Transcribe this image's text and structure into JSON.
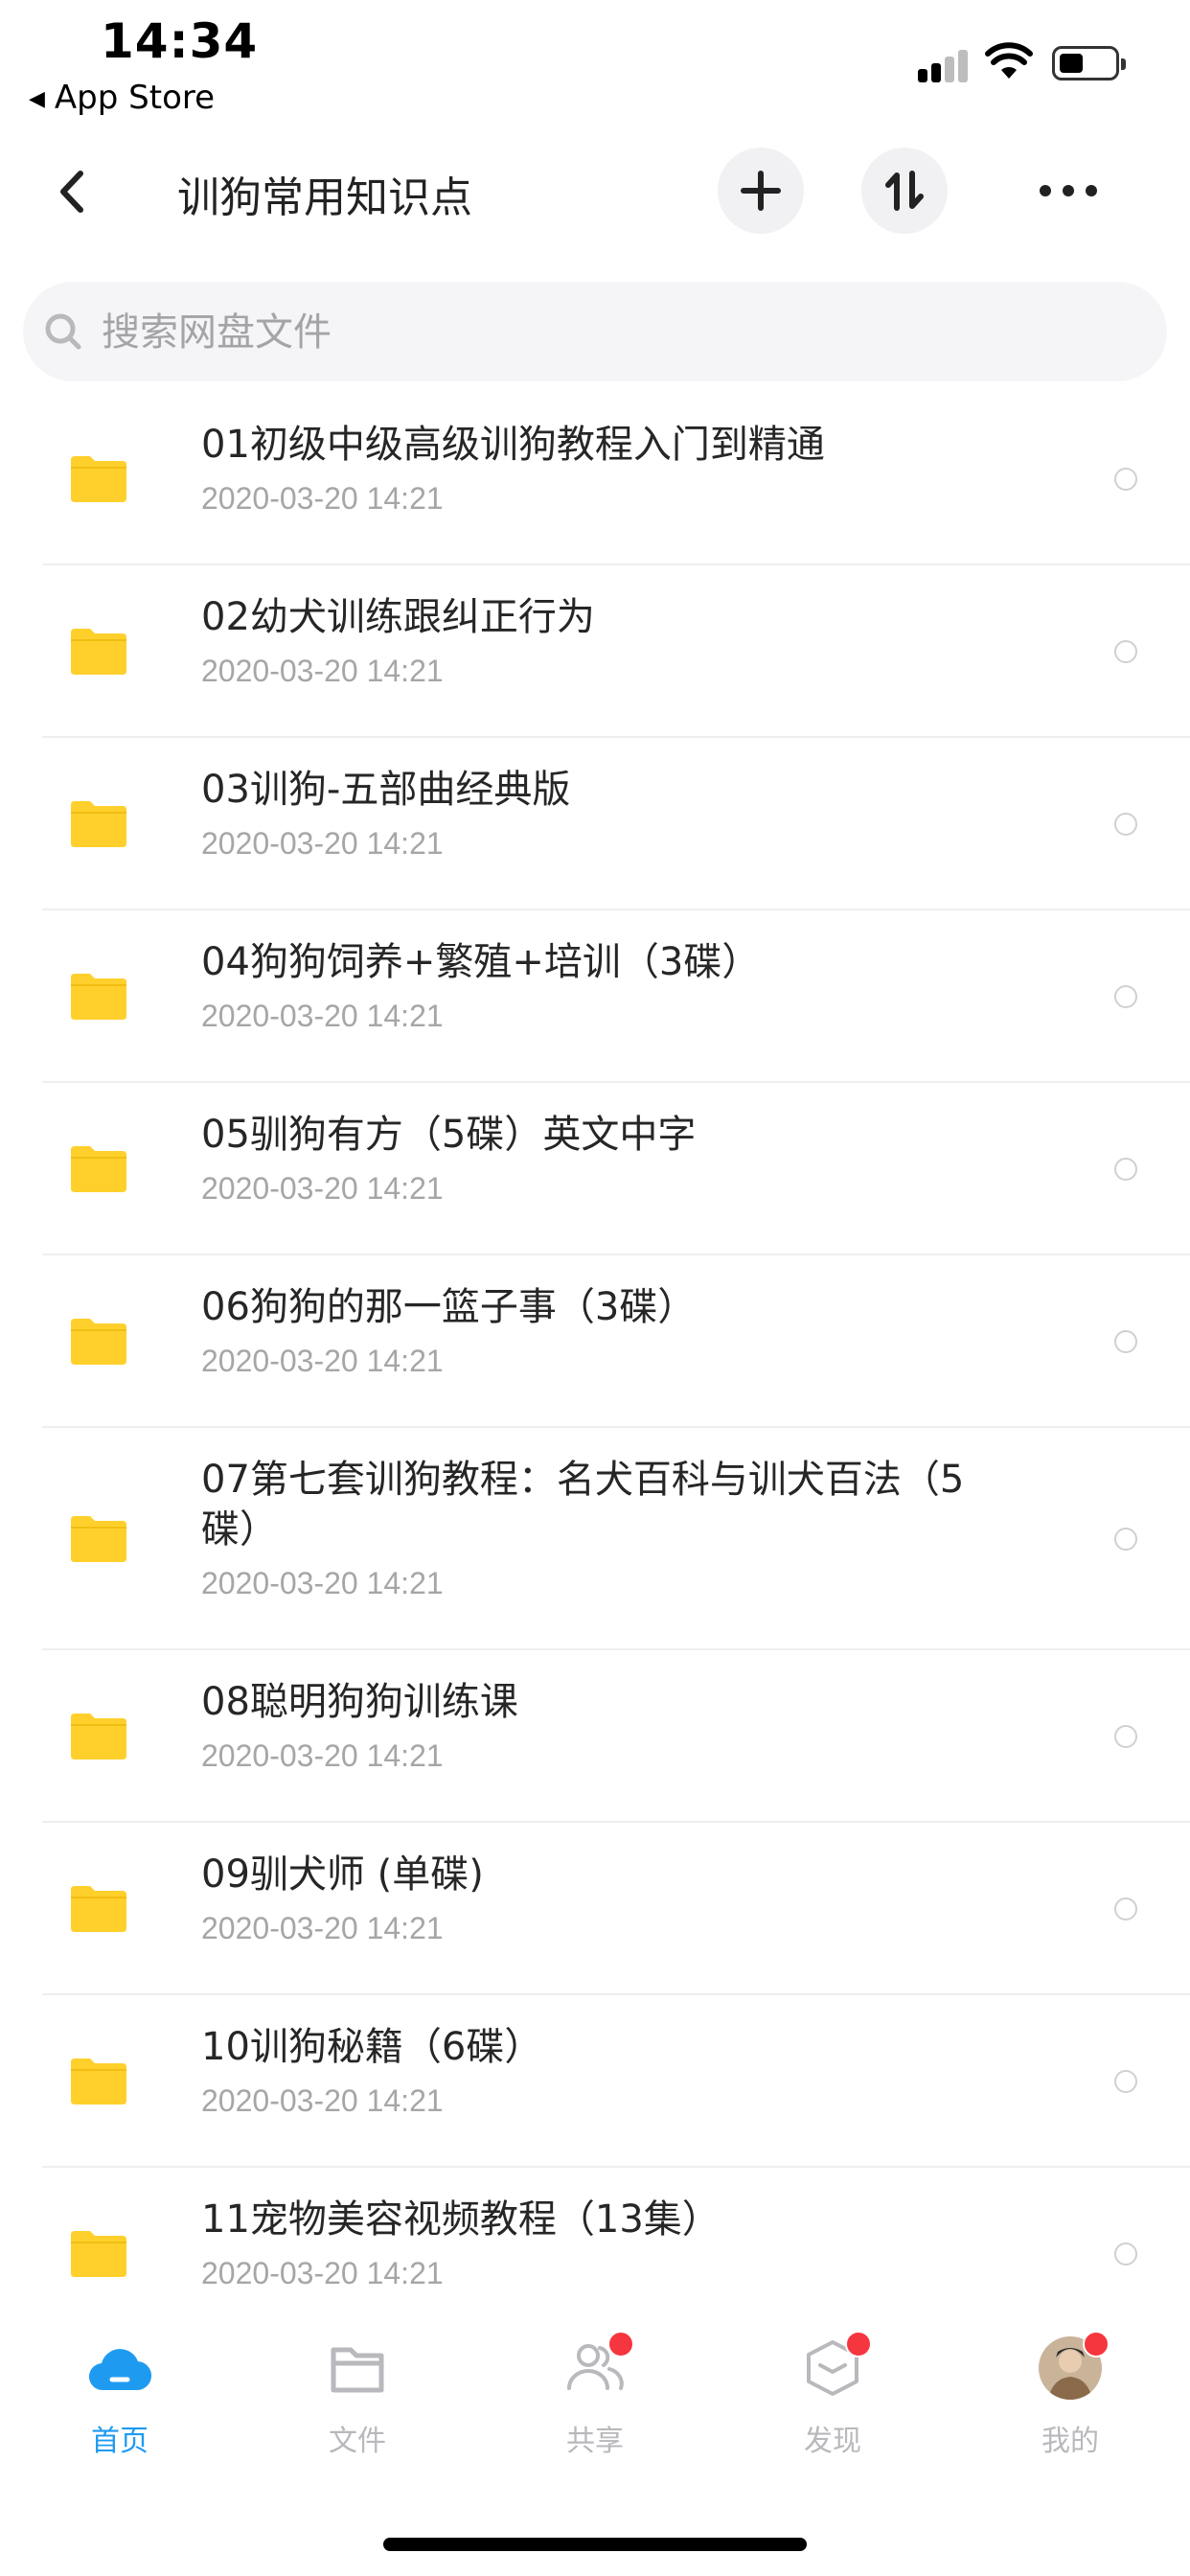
{
  "status_bar": {
    "time": "14:34",
    "back_app_label": "App Store"
  },
  "nav": {
    "title": "训狗常用知识点",
    "icons": [
      "back-chevron-icon",
      "plus-icon",
      "sort-icon",
      "more-icon"
    ]
  },
  "search": {
    "placeholder": "搜索网盘文件",
    "value": ""
  },
  "files": [
    {
      "name": "01初级中级高级训狗教程入门到精通",
      "date": "2020-03-20 14:21"
    },
    {
      "name": "02幼犬训练跟纠正行为",
      "date": "2020-03-20 14:21"
    },
    {
      "name": "03训狗-五部曲经典版",
      "date": "2020-03-20 14:21"
    },
    {
      "name": "04狗狗饲养+繁殖+培训（3碟）",
      "date": "2020-03-20 14:21"
    },
    {
      "name": "05驯狗有方（5碟）英文中字",
      "date": "2020-03-20 14:21"
    },
    {
      "name": "06狗狗的那一篮子事（3碟）",
      "date": "2020-03-20 14:21"
    },
    {
      "name": "07第七套训狗教程：名犬百科与训犬百法（5碟）",
      "date": "2020-03-20 14:21"
    },
    {
      "name": "08聪明狗狗训练课",
      "date": "2020-03-20 14:21"
    },
    {
      "name": "09驯犬师 (单碟)",
      "date": "2020-03-20 14:21"
    },
    {
      "name": "10训狗秘籍（6碟）",
      "date": "2020-03-20 14:21"
    },
    {
      "name": "11宠物美容视频教程（13集）",
      "date": "2020-03-20 14:21"
    }
  ],
  "tabs": [
    {
      "label": "首页",
      "icon": "cloud-icon",
      "active": true,
      "badge": false
    },
    {
      "label": "文件",
      "icon": "folder-icon",
      "active": false,
      "badge": false
    },
    {
      "label": "共享",
      "icon": "people-icon",
      "active": false,
      "badge": true
    },
    {
      "label": "发现",
      "icon": "discover-box-icon",
      "active": false,
      "badge": true
    },
    {
      "label": "我的",
      "icon": "avatar",
      "active": false,
      "badge": true
    }
  ],
  "colors": {
    "accent": "#1e9bf0",
    "folder": "#ffd02c",
    "badge": "#f5363f",
    "muted": "#a6a6a6"
  }
}
